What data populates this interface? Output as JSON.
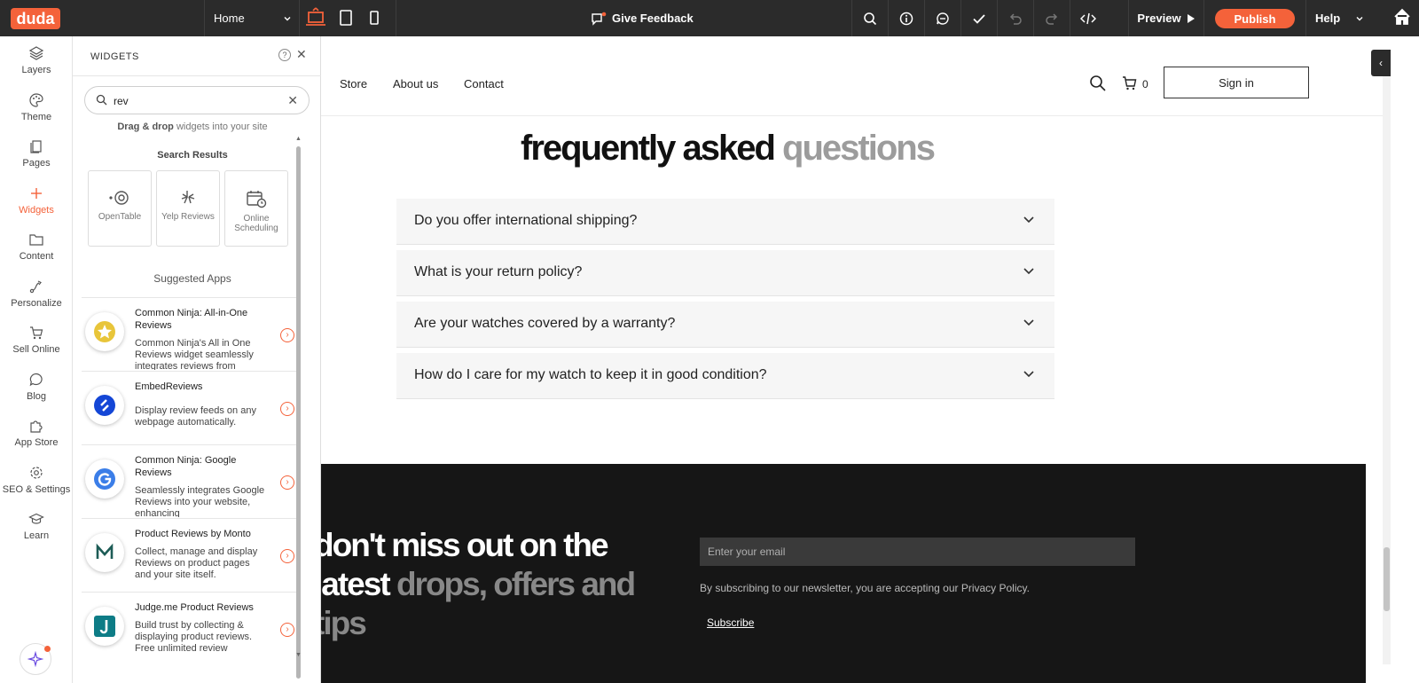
{
  "topbar": {
    "logo": "duda",
    "page_select": "Home",
    "give_feedback": "Give Feedback",
    "preview": "Preview",
    "publish": "Publish",
    "help": "Help"
  },
  "left_nav": {
    "items": [
      {
        "label": "Layers",
        "icon": "layers-icon"
      },
      {
        "label": "Theme",
        "icon": "palette-icon"
      },
      {
        "label": "Pages",
        "icon": "pages-icon"
      },
      {
        "label": "Widgets",
        "icon": "plus-icon",
        "active": true
      },
      {
        "label": "Content",
        "icon": "folder-icon"
      },
      {
        "label": "Personalize",
        "icon": "personalize-icon"
      },
      {
        "label": "Sell Online",
        "icon": "cart-icon"
      },
      {
        "label": "Blog",
        "icon": "chat-bubble-icon"
      },
      {
        "label": "App Store",
        "icon": "puzzle-icon"
      },
      {
        "label": "SEO & Settings",
        "icon": "gear-icon"
      },
      {
        "label": "Learn",
        "icon": "graduation-cap-icon"
      }
    ]
  },
  "widgets_panel": {
    "title": "WIDGETS",
    "search_value": "rev",
    "hint_bold": "Drag & drop",
    "hint_rest": " widgets into your site",
    "search_results_title": "Search Results",
    "results": [
      {
        "label": "OpenTable"
      },
      {
        "label": "Yelp Reviews"
      },
      {
        "label": "Online Scheduling"
      }
    ],
    "suggested_title": "Suggested Apps",
    "apps": [
      {
        "name": "Common Ninja: All-in-One Reviews",
        "desc": "Common Ninja's All in One Reviews widget seamlessly integrates reviews from"
      },
      {
        "name": "EmbedReviews",
        "desc": "Display review feeds on any webpage automatically."
      },
      {
        "name": "Common Ninja: Google Reviews",
        "desc": "Seamlessly integrates Google Reviews into your website, enhancing"
      },
      {
        "name": "Product Reviews by Monto",
        "desc": "Collect, manage and display Reviews on product pages and your site itself."
      },
      {
        "name": "Judge.me Product Reviews",
        "desc": "Build trust by collecting & displaying product reviews. Free unlimited review"
      }
    ]
  },
  "site": {
    "nav": [
      "Store",
      "About us",
      "Contact"
    ],
    "cart_count": "0",
    "sign_in": "Sign in",
    "faq_title_dark": "frequently asked ",
    "faq_title_light": "questions",
    "faq": [
      "Do you offer international shipping?",
      "What is your return policy?",
      "Are your watches covered by a warranty?",
      "How do I care for my watch to keep it in good condition?"
    ],
    "newsletter_head_white": "don't miss out on the latest ",
    "newsletter_head_grey": "drops, offers and tips",
    "email_placeholder": "Enter your email",
    "legal": "By subscribing to our newsletter, you are accepting our Privacy Policy.",
    "subscribe": "Subscribe"
  },
  "colors": {
    "accent": "#f4623a",
    "topbar": "#2b2b2b",
    "footer": "#161616"
  }
}
